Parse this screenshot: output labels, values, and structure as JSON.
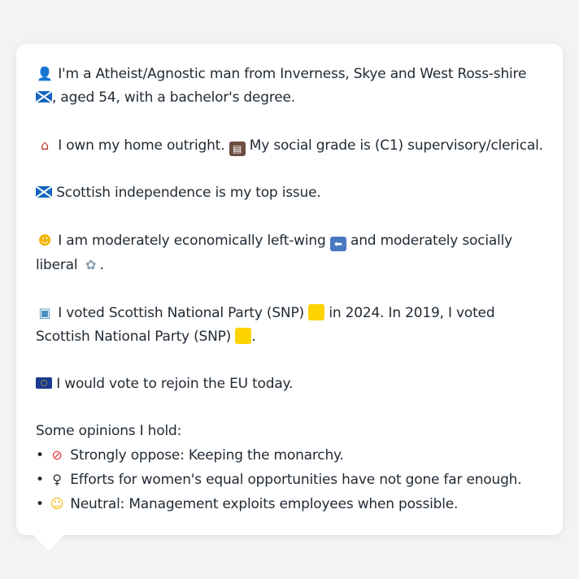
{
  "colors": {
    "background": "#f1f3f5",
    "bubble": "#ffffff",
    "text": "#1f2933",
    "scotland_flag": "#1565c0",
    "eu_flag": "#1a3a8f",
    "snp_swatch": "#fdd300",
    "left_arrow_box": "#4a78c2"
  },
  "profile": {
    "identity": {
      "icon": "person-silhouette-icon",
      "text_a": "I'm a Atheist/Agnostic man from Inverness, Skye and West Ross-shire",
      "flag_icon": "scotland-flag-icon",
      "text_b": ", aged 54, with a bachelor's degree."
    },
    "home": {
      "icon": "house-icon",
      "text_a": "I own my home outright.",
      "briefcase_icon": "briefcase-icon",
      "text_b": "My social grade is (C1) supervisory/clerical."
    },
    "issue": {
      "icon": "scotland-flag-icon",
      "text": "Scottish independence is my top issue."
    },
    "ideology": {
      "icon": "thinking-face-icon",
      "text_a": "I am moderately economically left-wing",
      "arrow_icon": "left-arrow-icon",
      "text_b": "and moderately socially liberal",
      "dove_icon": "dove-icon",
      "text_c": "."
    },
    "vote": {
      "icon": "ballot-box-icon",
      "text_a": "I voted Scottish National Party (SNP)",
      "swatch_icon": "yellow-square-icon",
      "text_b": "in 2024. In 2019, I voted Scottish National Party (SNP)",
      "text_c": "."
    },
    "eu": {
      "icon": "eu-flag-icon",
      "text": "I would vote to rejoin the EU today."
    },
    "opinions": {
      "heading": "Some opinions I hold:",
      "items": [
        {
          "bullet": "•",
          "icon": "prohibited-icon",
          "text": "Strongly oppose: Keeping the monarchy."
        },
        {
          "bullet": "•",
          "icon": "female-sign-icon",
          "text": "Efforts for women's equal opportunities have not gone far enough."
        },
        {
          "bullet": "•",
          "icon": "neutral-face-icon",
          "text": "Neutral: Management exploits employees when possible."
        }
      ]
    }
  }
}
